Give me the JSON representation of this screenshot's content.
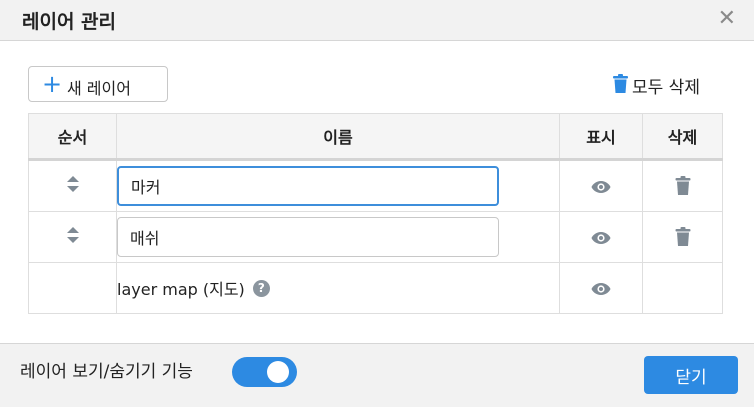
{
  "dialog": {
    "title": "레이어 관리",
    "close_icon": "close-icon"
  },
  "toolbar": {
    "new_layer_label": "새 레이어",
    "new_layer_icon": "plus-icon",
    "delete_all_label": "모두 삭제",
    "delete_all_icon": "trash-icon"
  },
  "table": {
    "headers": {
      "order": "순서",
      "name": "이름",
      "visible": "표시",
      "delete": "삭제"
    },
    "rows": [
      {
        "name": "마커",
        "editable": true,
        "focused": true,
        "visible_icon": "eye-icon",
        "delete_icon": "trash-icon"
      },
      {
        "name": "매쉬",
        "editable": true,
        "focused": false,
        "visible_icon": "eye-icon",
        "delete_icon": "trash-icon"
      },
      {
        "name": "layer map (지도)",
        "editable": false,
        "help_icon": "question-circle-icon",
        "visible_icon": "eye-icon"
      }
    ]
  },
  "footer": {
    "toggle_label": "레이어 보기/숨기기 기능",
    "toggle_on": true,
    "close_button_label": "닫기"
  },
  "colors": {
    "accent": "#2d8ae2",
    "icon_gray": "#7f8a94"
  }
}
